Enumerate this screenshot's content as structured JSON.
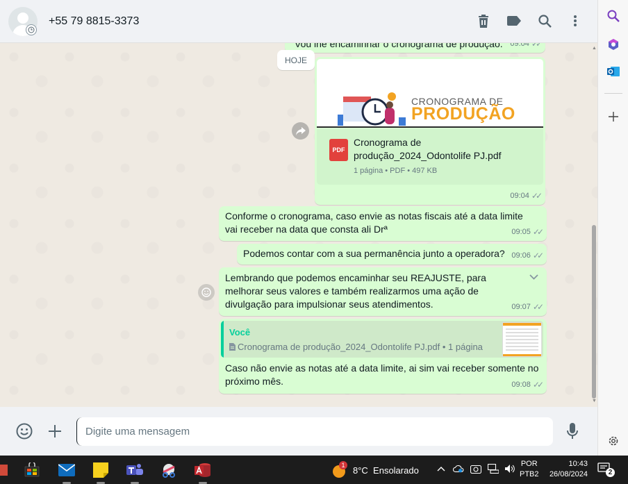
{
  "header": {
    "contact_name": "+55 79 8815-3373",
    "icons": [
      "delete-icon",
      "label-icon",
      "search-icon",
      "menu-icon"
    ]
  },
  "chat": {
    "date_label": "HOJE",
    "messages": [
      {
        "text": "Vou lhe encaminhar o cronograma de produção.",
        "time": "09:04"
      },
      {
        "type": "document",
        "preview_title_line1": "CRONOGRAMA DE",
        "preview_title_line2": "PRODUÇÃO",
        "file_icon_label": "PDF",
        "file_name": "Cronograma de produção_2024_Odontolife PJ.pdf",
        "file_meta": "1 página • PDF • 497 KB",
        "time": "09:04"
      },
      {
        "text": "Conforme o cronograma, caso envie as notas fiscais até a data limite vai receber na data que consta ali Drª",
        "time": "09:05"
      },
      {
        "text": "Podemos contar com a sua permanência junto a operadora?",
        "time": "09:06"
      },
      {
        "text": "Lembrando que podemos encaminhar seu REAJUSTE, para melhorar seus valores e também realizarmos uma ação de divulgação para impulsionar seus atendimentos.",
        "time": "09:07"
      },
      {
        "type": "reply",
        "quote_author": "Você",
        "quote_text": "Cronograma de produção_2024_Odontolife PJ.pdf • 1 página",
        "text": "Caso não envie as notas até a data limite, ai sim vai receber somente no próximo mês.",
        "time": "09:08"
      }
    ]
  },
  "composer": {
    "placeholder": "Digite uma mensagem"
  },
  "taskbar": {
    "weather_badge": "1",
    "weather_text": "8°C  Ensolarado",
    "lang_line1": "POR",
    "lang_line2": "PTB2",
    "time": "10:43",
    "date": "26/08/2024",
    "notification_count": "2"
  },
  "colors": {
    "outgoing_bubble": "#d9fdd3",
    "chat_bg": "#efeae2",
    "accent": "#06cf9c",
    "pdf_red": "#e2413c"
  }
}
